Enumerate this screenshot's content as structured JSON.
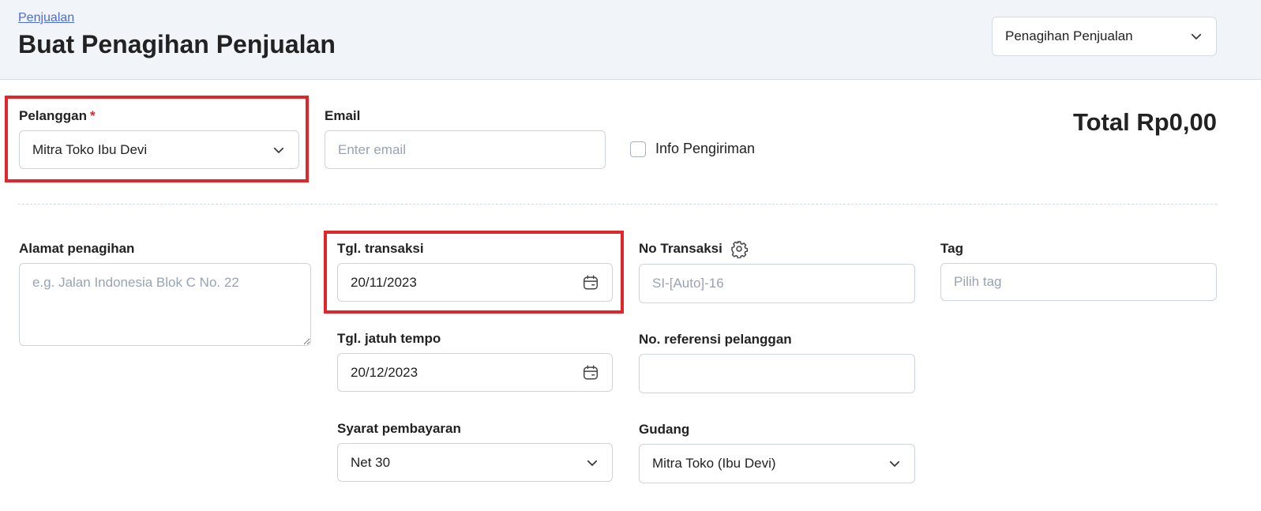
{
  "header": {
    "breadcrumb": "Penjualan",
    "title": "Buat Penagihan Penjualan",
    "doc_type_selected": "Penagihan Penjualan"
  },
  "customer": {
    "label": "Pelanggan",
    "required_mark": "*",
    "value": "Mitra Toko Ibu Devi"
  },
  "email": {
    "label": "Email",
    "placeholder": "Enter email"
  },
  "shipping_info": {
    "label": "Info Pengiriman",
    "checked": false
  },
  "total": "Total Rp0,00",
  "billing_address": {
    "label": "Alamat penagihan",
    "placeholder": "e.g. Jalan Indonesia Blok C No. 22"
  },
  "transaction_date": {
    "label": "Tgl. transaksi",
    "value": "20/11/2023"
  },
  "due_date": {
    "label": "Tgl. jatuh tempo",
    "value": "20/12/2023"
  },
  "payment_terms": {
    "label": "Syarat pembayaran",
    "value": "Net 30"
  },
  "transaction_no": {
    "label": "No Transaksi",
    "placeholder": "SI-[Auto]-16"
  },
  "customer_ref": {
    "label": "No. referensi pelanggan",
    "value": ""
  },
  "warehouse": {
    "label": "Gudang",
    "value": "Mitra Toko (Ibu Devi)"
  },
  "tag": {
    "label": "Tag",
    "placeholder": "Pilih tag"
  },
  "colors": {
    "highlight": "#e0262b",
    "link": "#4f6bd6",
    "header_bg": "#f1f4f9"
  }
}
